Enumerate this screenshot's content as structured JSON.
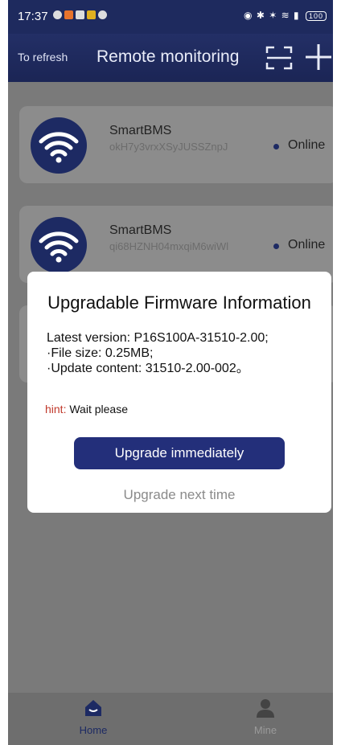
{
  "status_bar": {
    "time": "17:37",
    "battery": "100"
  },
  "header": {
    "refresh_label": "To refresh",
    "title": "Remote monitoring",
    "icons": [
      "scan-icon",
      "plus-icon"
    ]
  },
  "devices": [
    {
      "name": "SmartBMS",
      "id": "okH7y3vrxXSyJUSSZnpJ",
      "status": "Online"
    },
    {
      "name": "SmartBMS",
      "id": "qi68HZNH04mxqiM6wiWl",
      "status": "Online"
    }
  ],
  "dialog": {
    "title": "Upgradable Firmware Information",
    "latest_version": "Latest version:  P16S100A-31510-2.00;",
    "file_size": "·File size:  0.25MB;",
    "update_content": "·Update content:  31510-2.00-002。",
    "hint_label": "hint:",
    "hint_text": "Wait please",
    "primary_button": "Upgrade immediately",
    "secondary_button": "Upgrade next time"
  },
  "bottom_nav": [
    {
      "label": "Home",
      "icon": "home-icon",
      "active": true
    },
    {
      "label": "Mine",
      "icon": "person-icon",
      "active": false
    }
  ],
  "colors": {
    "primary": "#232f7a",
    "overlay": "#7a7a7a",
    "hint": "#c0392b"
  }
}
